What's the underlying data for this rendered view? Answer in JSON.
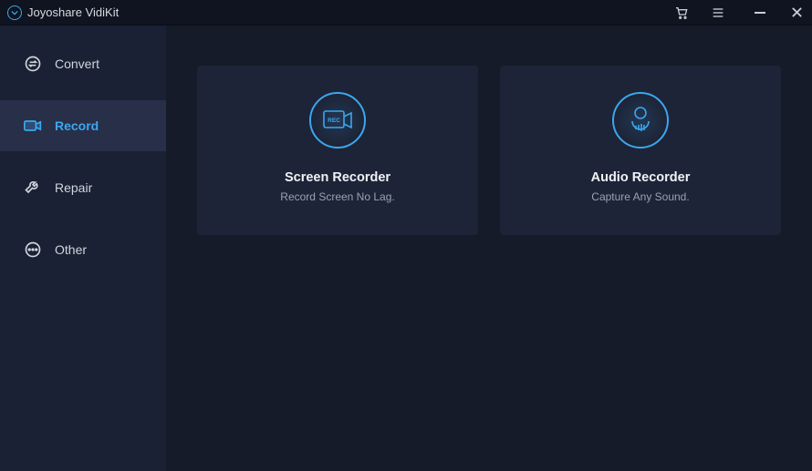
{
  "titlebar": {
    "title": "Joyoshare VidiKit"
  },
  "sidebar": {
    "items": [
      {
        "label": "Convert",
        "icon": "convert-icon"
      },
      {
        "label": "Record",
        "icon": "record-icon",
        "active": true
      },
      {
        "label": "Repair",
        "icon": "repair-icon"
      },
      {
        "label": "Other",
        "icon": "other-icon"
      }
    ]
  },
  "main": {
    "cards": [
      {
        "title": "Screen Recorder",
        "subtitle": "Record Screen No Lag.",
        "icon": "screen-recorder-icon"
      },
      {
        "title": "Audio Recorder",
        "subtitle": "Capture Any Sound.",
        "icon": "audio-recorder-icon"
      }
    ]
  },
  "colors": {
    "accent": "#3ba7ef",
    "bg_main": "#151b28",
    "bg_sidebar": "#1a2134",
    "bg_sidebar_active": "#282f49",
    "bg_card": "#1d2437",
    "text_primary": "#f0f2f5",
    "text_secondary": "#9aa1b0"
  }
}
